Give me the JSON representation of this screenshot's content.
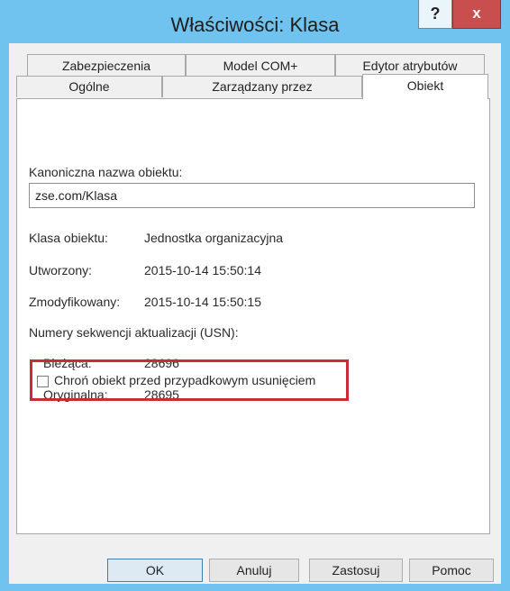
{
  "window": {
    "title": "Właściwości: Klasa",
    "help_label": "?",
    "close_label": "x"
  },
  "tabs": {
    "row1": [
      "Zabezpieczenia",
      "Model COM+",
      "Edytor atrybutów"
    ],
    "row2": [
      "Ogólne",
      "Zarządzany przez",
      "Obiekt"
    ],
    "active": "Obiekt"
  },
  "object": {
    "canonical_name_label": "Kanoniczna nazwa obiektu:",
    "canonical_name_value": "zse.com/Klasa",
    "class_label": "Klasa obiektu:",
    "class_value": "Jednostka organizacyjna",
    "created_label": "Utworzony:",
    "created_value": "2015-10-14 15:50:14",
    "modified_label": "Zmodyfikowany:",
    "modified_value": "2015-10-14 15:50:15",
    "usn_label": "Numery sekwencji aktualizacji (USN):",
    "usn_current_label": "Bieżąca:",
    "usn_current_value": "28696",
    "usn_original_label": "Oryginalna:",
    "usn_original_value": "28695",
    "protect_label": "Chroń obiekt przed przypadkowym usunięciem",
    "protect_checked": false
  },
  "buttons": {
    "ok": "OK",
    "cancel": "Anuluj",
    "apply": "Zastosuj",
    "help": "Pomoc"
  },
  "colors": {
    "title_bar": "#6fc3ee",
    "close_button": "#c94e4e",
    "highlight_border": "#cc2a36"
  }
}
